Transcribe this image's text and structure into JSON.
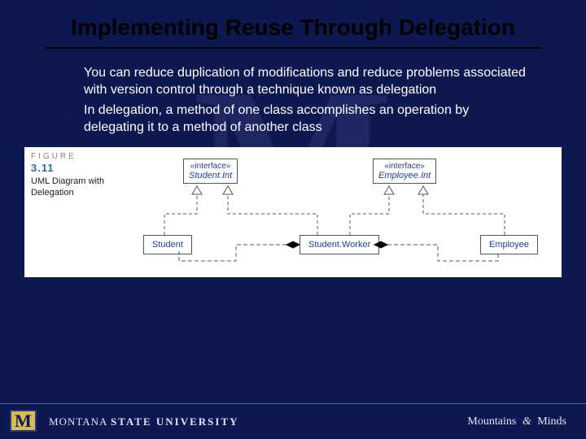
{
  "title": "Implementing Reuse Through Delegation",
  "bullets": [
    "You can reduce duplication of modifications and reduce problems associated with version control through a technique known as delegation",
    "In delegation, a method of one class accomplishes an operation by delegating it to a method of another class"
  ],
  "figure": {
    "label": "FIGURE",
    "number": "3.11",
    "caption": "UML Diagram with Delegation",
    "interfaces": [
      {
        "stereo": "«interface»",
        "name": "Student.Int"
      },
      {
        "stereo": "«interface»",
        "name": "Employee.Int"
      }
    ],
    "classes": [
      "Student",
      "Student.Worker",
      "Employee"
    ]
  },
  "footer": {
    "university_thin": "MONTANA",
    "university_bold": "STATE UNIVERSITY",
    "tagline_a": "Mountains",
    "tagline_amp": "&",
    "tagline_b": "Minds",
    "logo_letter": "M"
  }
}
